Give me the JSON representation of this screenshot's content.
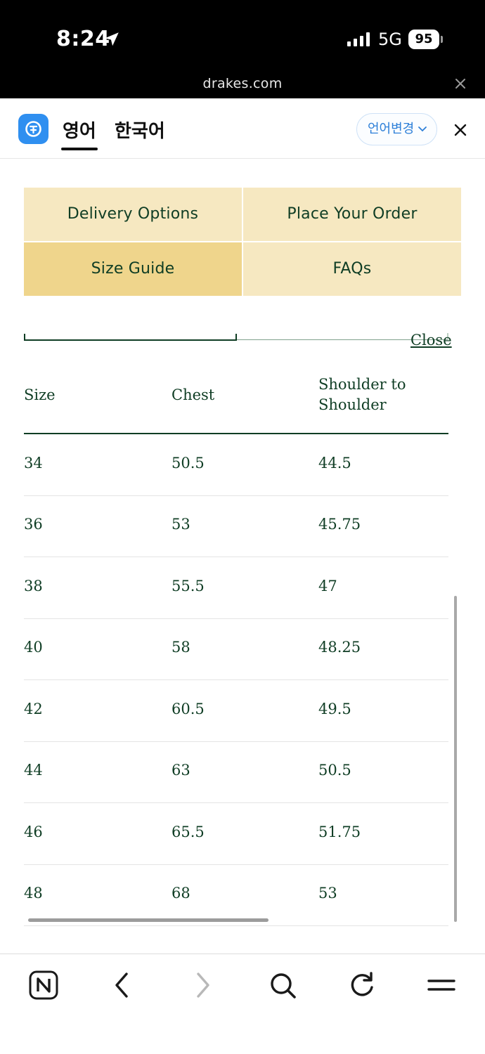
{
  "status_bar": {
    "time": "8:24",
    "network": "5G",
    "battery": "95",
    "url": "drakes.com"
  },
  "translate_bar": {
    "tab_english": "영어",
    "tab_korean": "한국어",
    "change_language": "언어변경",
    "accent_color": "#2f8ff0"
  },
  "nav": {
    "delivery": "Delivery Options",
    "order": "Place Your Order",
    "size_guide": "Size Guide",
    "faqs": "FAQs",
    "active": "Size Guide"
  },
  "size_table": {
    "close_label": "Close",
    "headers": {
      "size": "Size",
      "chest": "Chest",
      "shoulder": "Shoulder to Shoulder"
    },
    "rows": [
      {
        "size": "34",
        "chest": "50.5",
        "shoulder": "44.5"
      },
      {
        "size": "36",
        "chest": "53",
        "shoulder": "45.75"
      },
      {
        "size": "38",
        "chest": "55.5",
        "shoulder": "47"
      },
      {
        "size": "40",
        "chest": "58",
        "shoulder": "48.25"
      },
      {
        "size": "42",
        "chest": "60.5",
        "shoulder": "49.5"
      },
      {
        "size": "44",
        "chest": "63",
        "shoulder": "50.5"
      },
      {
        "size": "46",
        "chest": "65.5",
        "shoulder": "51.75"
      },
      {
        "size": "48",
        "chest": "68",
        "shoulder": "53"
      }
    ]
  },
  "toolbar": {
    "icons": [
      "naver-n-icon",
      "back-arrow-icon",
      "forward-arrow-icon",
      "search-icon",
      "reload-icon",
      "menu-icon"
    ]
  }
}
